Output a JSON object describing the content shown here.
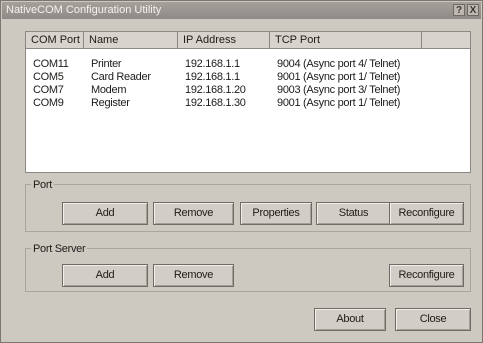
{
  "window": {
    "title": "NativeCOM Configuration Utility",
    "help_btn": "?",
    "close_btn": "X"
  },
  "list": {
    "columns": [
      "COM Port",
      "Name",
      "IP Address",
      "TCP Port",
      ""
    ],
    "rows": [
      [
        "COM11",
        "Printer",
        "192.168.1.1",
        "9004 (Async port 4/ Telnet)"
      ],
      [
        "COM5",
        "Card Reader",
        "192.168.1.1",
        "9001 (Async port 1/ Telnet)"
      ],
      [
        "COM7",
        "Modem",
        "192.168.1.20",
        "9003 (Async port 3/ Telnet)"
      ],
      [
        "COM9",
        "Register",
        "192.168.1.30",
        "9001 (Async port 1/ Telnet)"
      ]
    ]
  },
  "port_group": {
    "label": "Port",
    "add": "Add",
    "remove": "Remove",
    "properties": "Properties",
    "status": "Status",
    "reconfigure": "Reconfigure"
  },
  "port_server_group": {
    "label": "Port Server",
    "add": "Add",
    "remove": "Remove",
    "reconfigure": "Reconfigure"
  },
  "footer": {
    "about": "About",
    "close": "Close"
  }
}
